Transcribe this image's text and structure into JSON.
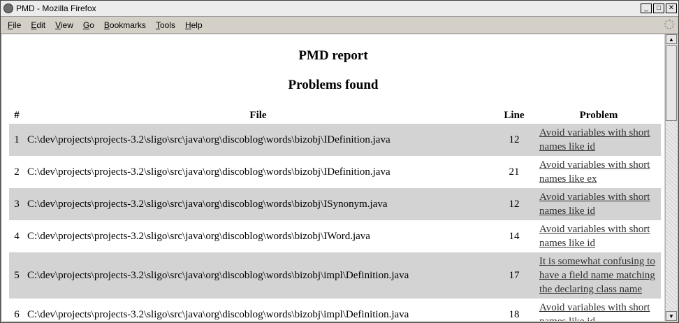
{
  "window": {
    "title": "PMD - Mozilla Firefox"
  },
  "menu": [
    "File",
    "Edit",
    "View",
    "Go",
    "Bookmarks",
    "Tools",
    "Help"
  ],
  "page": {
    "title": "PMD report",
    "section": "Problems found",
    "columns": [
      "#",
      "File",
      "Line",
      "Problem"
    ],
    "rows": [
      {
        "n": "1",
        "file": "C:\\dev\\projects\\projects-3.2\\sligo\\src\\java\\org\\discoblog\\words\\bizobj\\IDefinition.java",
        "line": "12",
        "problem": "Avoid variables with short names like id"
      },
      {
        "n": "2",
        "file": "C:\\dev\\projects\\projects-3.2\\sligo\\src\\java\\org\\discoblog\\words\\bizobj\\IDefinition.java",
        "line": "21",
        "problem": "Avoid variables with short names like ex"
      },
      {
        "n": "3",
        "file": "C:\\dev\\projects\\projects-3.2\\sligo\\src\\java\\org\\discoblog\\words\\bizobj\\ISynonym.java",
        "line": "12",
        "problem": "Avoid variables with short names like id"
      },
      {
        "n": "4",
        "file": "C:\\dev\\projects\\projects-3.2\\sligo\\src\\java\\org\\discoblog\\words\\bizobj\\IWord.java",
        "line": "14",
        "problem": "Avoid variables with short names like id"
      },
      {
        "n": "5",
        "file": "C:\\dev\\projects\\projects-3.2\\sligo\\src\\java\\org\\discoblog\\words\\bizobj\\impl\\Definition.java",
        "line": "17",
        "problem": "It is somewhat confusing to have a field name matching the declaring class name"
      },
      {
        "n": "6",
        "file": "C:\\dev\\projects\\projects-3.2\\sligo\\src\\java\\org\\discoblog\\words\\bizobj\\impl\\Definition.java",
        "line": "18",
        "problem": "Avoid variables with short names like id"
      }
    ]
  }
}
